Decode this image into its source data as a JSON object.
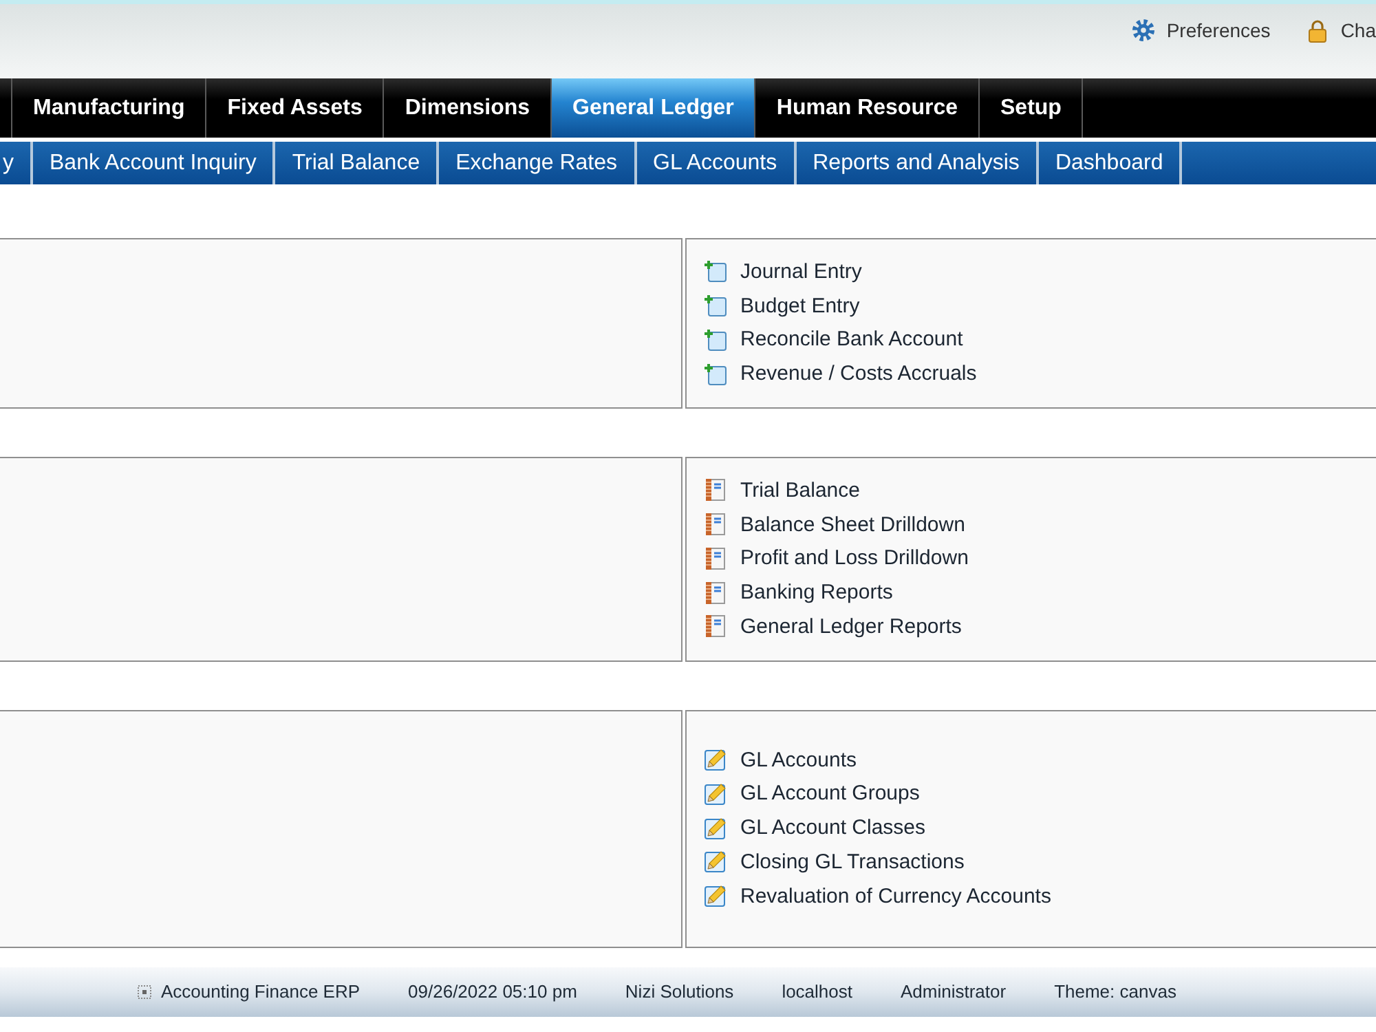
{
  "header": {
    "links": [
      {
        "kind": "preferences",
        "label": "Preferences"
      },
      {
        "kind": "password",
        "label": "Cha"
      }
    ]
  },
  "main_menu": [
    {
      "label": "Manufacturing",
      "selected": false
    },
    {
      "label": "Fixed Assets",
      "selected": false
    },
    {
      "label": "Dimensions",
      "selected": false
    },
    {
      "label": "General Ledger",
      "selected": true
    },
    {
      "label": "Human Resource",
      "selected": false
    },
    {
      "label": "Setup",
      "selected": false
    }
  ],
  "sub_menu": [
    {
      "label": "y"
    },
    {
      "label": "Bank Account Inquiry"
    },
    {
      "label": "Trial Balance"
    },
    {
      "label": "Exchange Rates"
    },
    {
      "label": "GL Accounts"
    },
    {
      "label": "Reports and Analysis"
    },
    {
      "label": "Dashboard"
    }
  ],
  "sections": [
    {
      "kind": "entry",
      "items": [
        {
          "label": "Journal Entry"
        },
        {
          "label": "Budget Entry"
        },
        {
          "label": "Reconcile Bank Account"
        },
        {
          "label": "Revenue / Costs Accruals"
        }
      ]
    },
    {
      "kind": "report",
      "items": [
        {
          "label": "Trial Balance"
        },
        {
          "label": "Balance Sheet Drilldown"
        },
        {
          "label": "Profit and Loss Drilldown"
        },
        {
          "label": "Banking Reports"
        },
        {
          "label": "General Ledger Reports"
        }
      ]
    },
    {
      "kind": "maintenance",
      "items": [
        {
          "label": "GL Accounts"
        },
        {
          "label": "GL Account Groups"
        },
        {
          "label": "GL Account Classes"
        },
        {
          "label": "Closing GL Transactions"
        },
        {
          "label": "Revaluation of Currency Accounts"
        }
      ]
    }
  ],
  "footer": {
    "items": [
      "Accounting Finance ERP",
      "09/26/2022 05:10 pm",
      "Nizi Solutions",
      "localhost",
      "Administrator",
      "Theme: canvas"
    ]
  }
}
